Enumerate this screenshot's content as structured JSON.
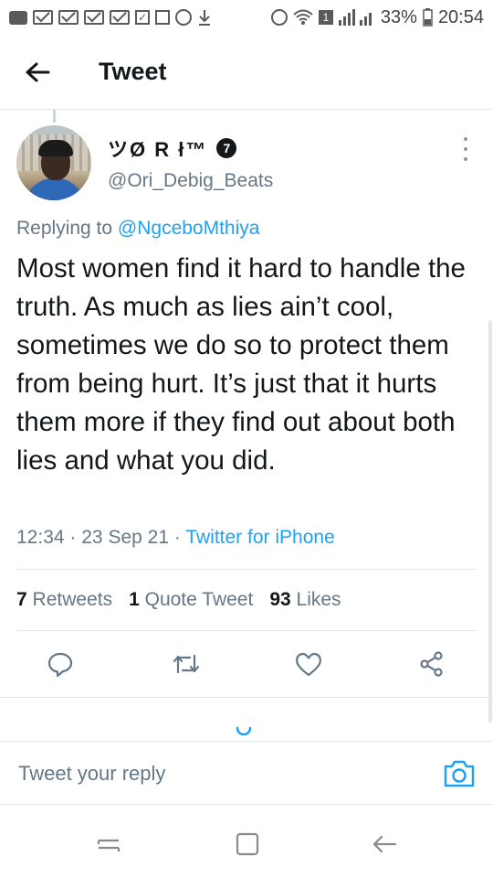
{
  "status_bar": {
    "battery": "33%",
    "time": "20:54",
    "sim": "1"
  },
  "header": {
    "title": "Tweet",
    "back_icon": "arrow-left-icon"
  },
  "tweet": {
    "display_name": "ツØ R ł™",
    "badge": "7",
    "handle": "@Ori_Debig_Beats",
    "replying_prefix": "Replying to",
    "replying_to": "@NgceboMthiya",
    "text": "Most women find it hard to handle the truth. As much as lies ain’t cool, sometimes we do so to protect them from being hurt. It’s just that it hurts them more if they find out about both lies and what you did.",
    "time": "12:34",
    "date": "23 Sep 21",
    "source": "Twitter for iPhone",
    "sep": "·"
  },
  "stats": {
    "retweets_count": "7",
    "retweets_label": "Retweets",
    "quotes_count": "1",
    "quotes_label": "Quote Tweet",
    "likes_count": "93",
    "likes_label": "Likes"
  },
  "actions": [
    "reply-icon",
    "retweet-icon",
    "like-icon",
    "share-icon"
  ],
  "reply_bar": {
    "placeholder": "Tweet your reply",
    "camera_icon": "camera-icon"
  },
  "colors": {
    "accent": "#1da1f2",
    "secondary_text": "#657786",
    "divider": "#e1e8ed"
  }
}
